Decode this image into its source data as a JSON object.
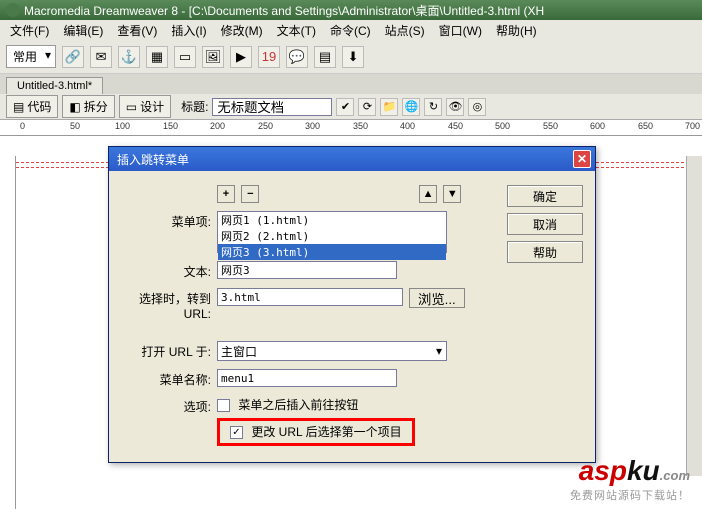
{
  "window": {
    "title": "Macromedia Dreamweaver 8 - [C:\\Documents and Settings\\Administrator\\桌面\\Untitled-3.html (XH"
  },
  "menu": {
    "file": "文件(F)",
    "edit": "编辑(E)",
    "view": "查看(V)",
    "insert": "插入(I)",
    "modify": "修改(M)",
    "text": "文本(T)",
    "commands": "命令(C)",
    "site": "站点(S)",
    "window": "窗口(W)",
    "help": "帮助(H)"
  },
  "toolbar": {
    "category": "常用"
  },
  "tab": {
    "name": "Untitled-3.html*"
  },
  "doctb": {
    "code": "代码",
    "split": "拆分",
    "design": "设计",
    "title_lbl": "标题:",
    "title_val": "无标题文档"
  },
  "ruler": {
    "marks": [
      "0",
      "50",
      "100",
      "150",
      "200",
      "250",
      "300",
      "350",
      "400",
      "450",
      "500",
      "550",
      "600",
      "650",
      "700"
    ]
  },
  "dialog": {
    "title": "插入跳转菜单",
    "ok": "确定",
    "cancel": "取消",
    "help": "帮助",
    "menuitems_lbl": "菜单项:",
    "items": [
      "网页1 (1.html)",
      "网页2 (2.html)",
      "网页3 (3.html)"
    ],
    "selected_index": 2,
    "text_lbl": "文本:",
    "text_val": "网页3",
    "url_lbl": "选择时，转到 URL:",
    "url_val": "3.html",
    "browse": "浏览...",
    "openin_lbl": "打开 URL 于:",
    "openin_val": "主窗口",
    "menuname_lbl": "菜单名称:",
    "menuname_val": "menu1",
    "options_lbl": "选项:",
    "opt1": "菜单之后插入前往按钮",
    "opt2": "更改 URL 后选择第一个项目",
    "opt1_checked": false,
    "opt2_checked": true
  },
  "watermark": {
    "brand_a": "asp",
    "brand_k": "ku",
    "dot": ".com",
    "sub": "免费网站源码下载站！"
  }
}
